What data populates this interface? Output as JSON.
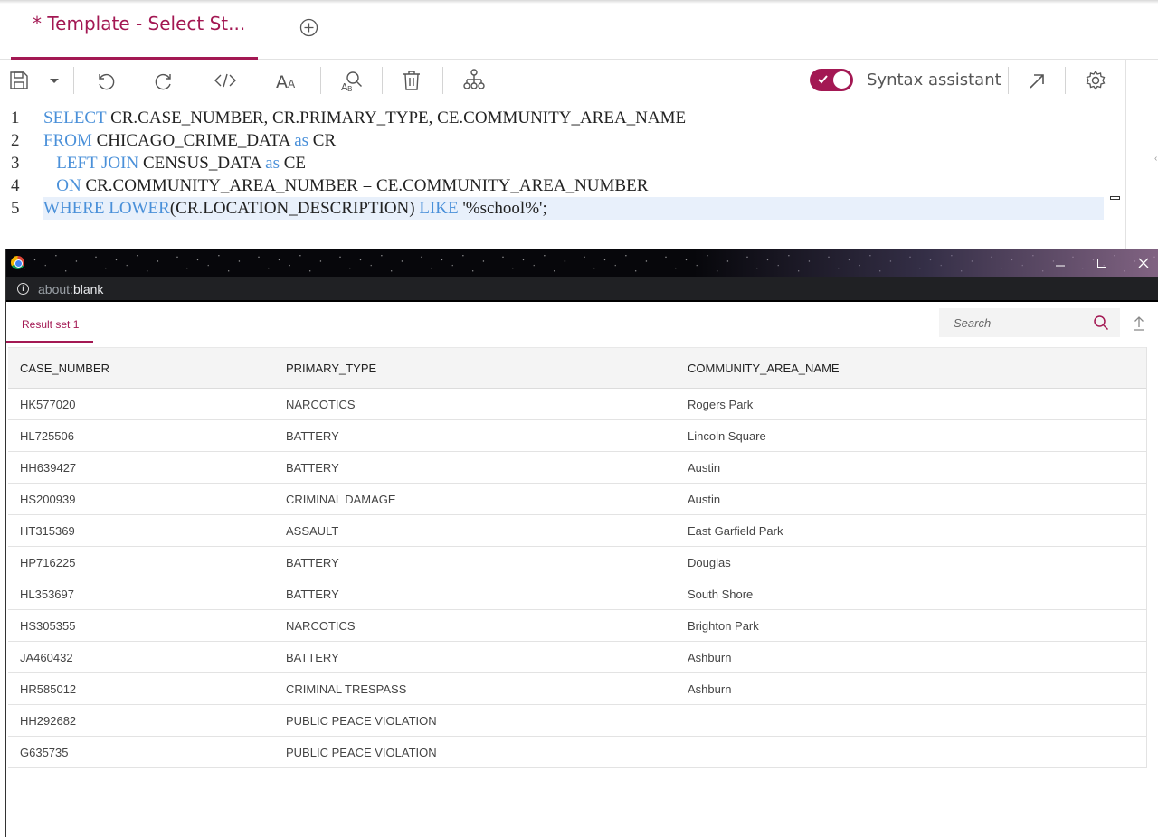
{
  "editor": {
    "tab_title": "* Template - Select St...",
    "syntax_assistant_label": "Syntax assistant",
    "syntax_assistant_on": true,
    "lines": [
      {
        "num": "1",
        "parts": [
          {
            "t": "SELECT",
            "k": 1
          },
          {
            "t": " CR.CASE_NUMBER, CR.PRIMARY_TYPE, CE.COMMUNITY_AREA_NAME",
            "k": 0
          }
        ]
      },
      {
        "num": "2",
        "parts": [
          {
            "t": "FROM",
            "k": 1
          },
          {
            "t": " CHICAGO_CRIME_DATA ",
            "k": 0
          },
          {
            "t": "as",
            "k": 1
          },
          {
            "t": " CR",
            "k": 0
          }
        ]
      },
      {
        "num": "3",
        "parts": [
          {
            "t": "   ",
            "k": 0
          },
          {
            "t": "LEFT JOIN",
            "k": 1
          },
          {
            "t": " CENSUS_DATA ",
            "k": 0
          },
          {
            "t": "as",
            "k": 1
          },
          {
            "t": " CE",
            "k": 0
          }
        ]
      },
      {
        "num": "4",
        "parts": [
          {
            "t": "   ",
            "k": 0
          },
          {
            "t": "ON",
            "k": 1
          },
          {
            "t": " CR.COMMUNITY_AREA_NUMBER = CE.COMMUNITY_AREA_NUMBER",
            "k": 0
          }
        ]
      },
      {
        "num": "5",
        "parts": [
          {
            "t": "WHERE",
            "k": 1
          },
          {
            "t": " ",
            "k": 0
          },
          {
            "t": "LOWER",
            "k": 1
          },
          {
            "t": "(CR.LOCATION_DESCRIPTION) ",
            "k": 0
          },
          {
            "t": "LIKE",
            "k": 1
          },
          {
            "t": " '%school%';",
            "k": 0
          }
        ]
      }
    ],
    "active_line": 5
  },
  "popup": {
    "url_prefix": "about:",
    "url_host": "blank",
    "result_tab_label": "Result set 1",
    "search_placeholder": "Search",
    "columns": [
      "CASE_NUMBER",
      "PRIMARY_TYPE",
      "COMMUNITY_AREA_NAME"
    ],
    "rows": [
      [
        "HK577020",
        "NARCOTICS",
        "Rogers Park"
      ],
      [
        "HL725506",
        "BATTERY",
        "Lincoln Square"
      ],
      [
        "HH639427",
        "BATTERY",
        "Austin"
      ],
      [
        "HS200939",
        "CRIMINAL DAMAGE",
        "Austin"
      ],
      [
        "HT315369",
        "ASSAULT",
        "East Garfield Park"
      ],
      [
        "HP716225",
        "BATTERY",
        "Douglas"
      ],
      [
        "HL353697",
        "BATTERY",
        "South Shore"
      ],
      [
        "HS305355",
        "NARCOTICS",
        "Brighton Park"
      ],
      [
        "JA460432",
        "BATTERY",
        "Ashburn"
      ],
      [
        "HR585012",
        "CRIMINAL TRESPASS",
        "Ashburn"
      ],
      [
        "HH292682",
        "PUBLIC PEACE VIOLATION",
        ""
      ],
      [
        "G635735",
        "PUBLIC PEACE VIOLATION",
        ""
      ]
    ]
  },
  "colors": {
    "accent": "#a31853",
    "keyword": "#4a90d9",
    "active_line": "#e8f0fb"
  }
}
